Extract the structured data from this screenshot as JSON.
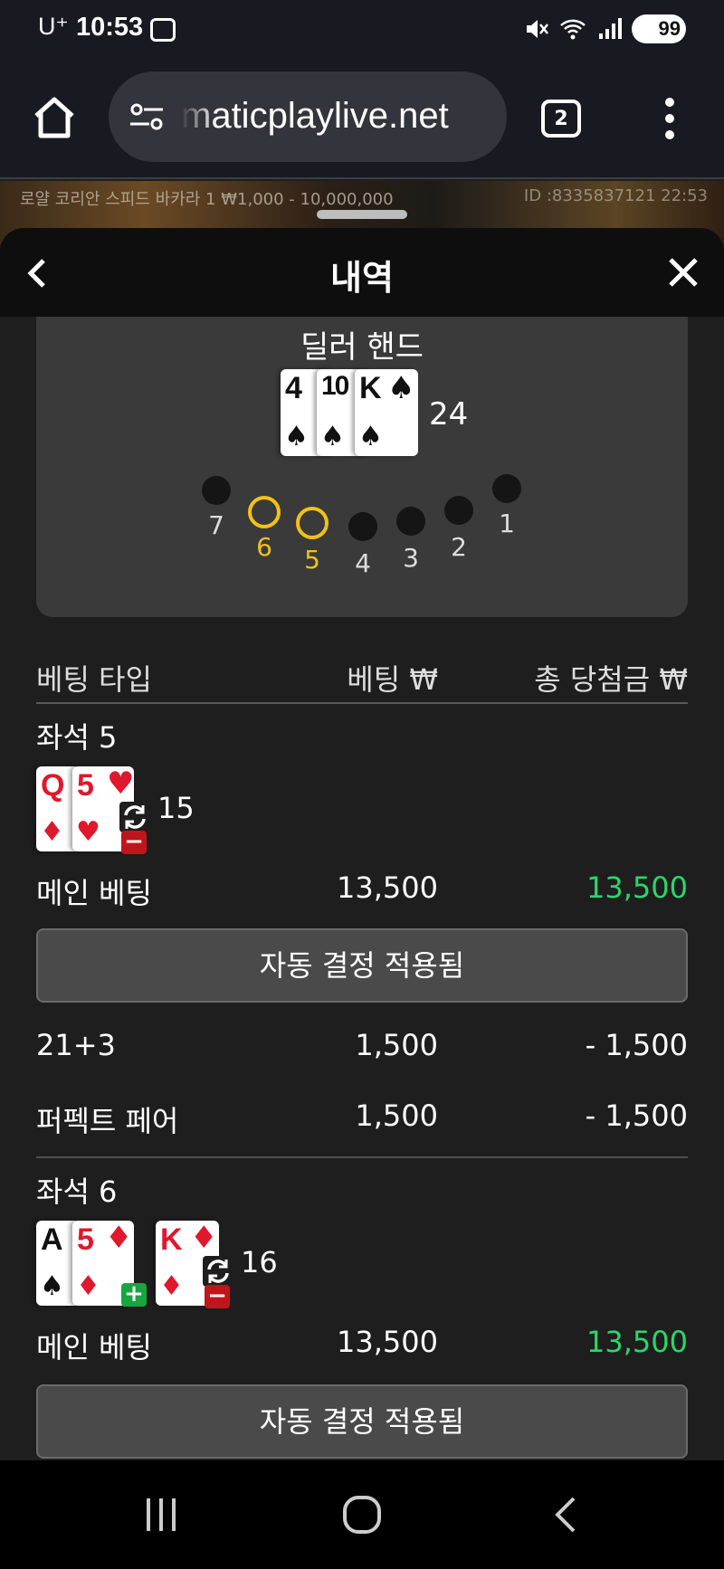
{
  "status": {
    "carrier": "U⁺",
    "time": "10:53",
    "battery": "99"
  },
  "browser": {
    "url": "maticplaylive.net",
    "tab_count": "2"
  },
  "banner": {
    "table_info": "로얄 코리안 스피드 바카라 1 ₩1,000 - 10,000,000",
    "game_id": "ID :8335837121 22:53"
  },
  "panel": {
    "title": "내역"
  },
  "dealer": {
    "label": "딜러 핸드",
    "cards": [
      {
        "rank": "4",
        "suit": "♠",
        "color": "black"
      },
      {
        "rank": "10",
        "suit": "♠",
        "color": "black"
      },
      {
        "rank": "K",
        "suit": "♠",
        "color": "black"
      }
    ],
    "total": "24",
    "seats": [
      "7",
      "6",
      "5",
      "4",
      "3",
      "2",
      "1"
    ],
    "active_seats": [
      "6",
      "5"
    ]
  },
  "table": {
    "col_type": "베팅 타입",
    "col_bet": "베팅 ₩",
    "col_win": "총 당첨금 ₩"
  },
  "seats": [
    {
      "title": "좌석 5",
      "cards": [
        {
          "rank": "Q",
          "suit": "♦",
          "color": "red"
        },
        {
          "rank": "5",
          "suit": "♥",
          "color": "red"
        }
      ],
      "total": "15",
      "rows": [
        {
          "label": "메인 베팅",
          "bet": "13,500",
          "win": "13,500",
          "win_positive": true
        },
        {
          "label": "21+3",
          "bet": "1,500",
          "win": "- 1,500",
          "win_positive": false
        },
        {
          "label": "퍼펙트 페어",
          "bet": "1,500",
          "win": "- 1,500",
          "win_positive": false
        }
      ],
      "auto_label": "자동 결정 적용됨"
    },
    {
      "title": "좌석 6",
      "cards_split_a": [
        {
          "rank": "A",
          "suit": "♠",
          "color": "black"
        },
        {
          "rank": "5",
          "suit": "♦",
          "color": "red"
        }
      ],
      "cards_split_b": [
        {
          "rank": "K",
          "suit": "♦",
          "color": "red"
        }
      ],
      "total": "16",
      "rows": [
        {
          "label": "메인 베팅",
          "bet": "13,500",
          "win": "13,500",
          "win_positive": true
        }
      ],
      "auto_label": "자동 결정 적용됨"
    }
  ],
  "colors": {
    "accent_gold": "#f2c214",
    "win_green": "#2bd66e",
    "badge_red": "#c0151b",
    "badge_green": "#17a540"
  }
}
